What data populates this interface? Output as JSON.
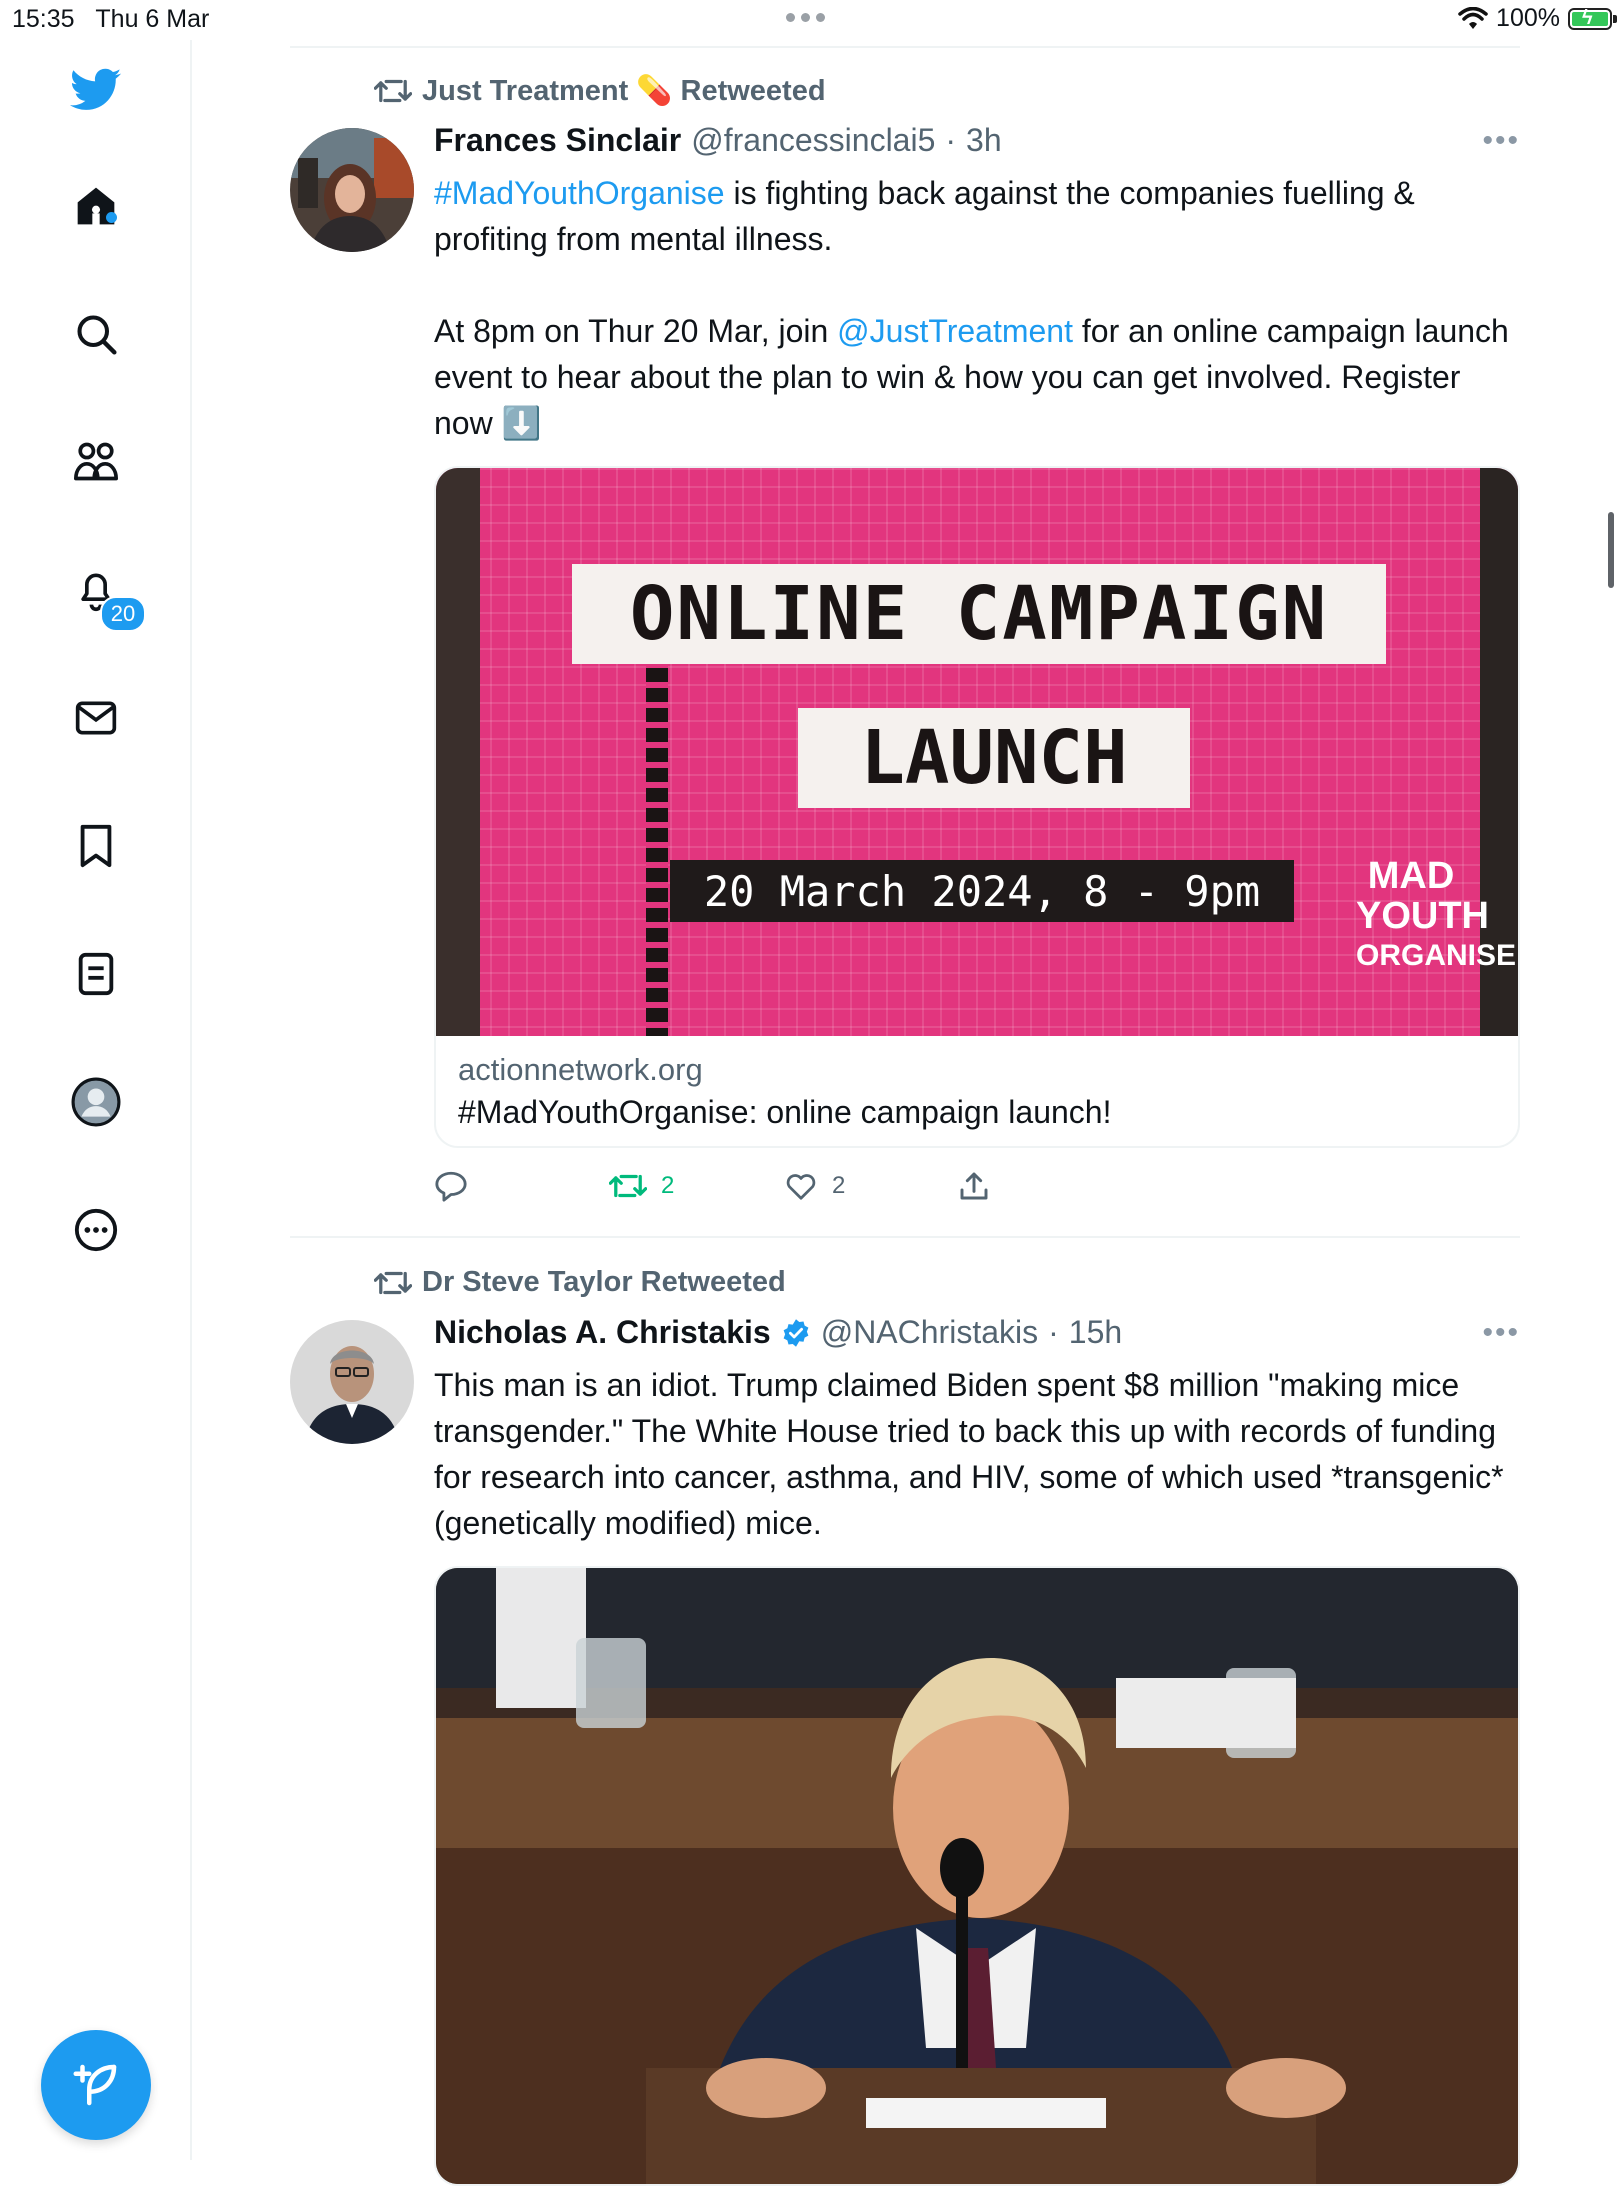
{
  "status_bar": {
    "time": "15:35",
    "date": "Thu 6 Mar",
    "battery": "100%"
  },
  "sidebar": {
    "notifications_badge": "20",
    "accent": "#1d9bf0"
  },
  "feed": {
    "tweets": [
      {
        "retweeted_by": "Just Treatment 💊 Retweeted",
        "name": "Frances Sinclair",
        "handle": "@francessinclai5",
        "time": "3h",
        "text_hashtag": "#MadYouthOrganise",
        "text_p1": " is fighting back against the companies fuelling & profiting from mental illness.",
        "text_p2_a": "At 8pm on Thur 20 Mar, join ",
        "text_mention": "@JustTreatment",
        "text_p2_b": " for an online campaign launch event to hear about the plan to win & how you can get involved. Register now ⬇️",
        "card": {
          "image_title_1": "ONLINE CAMPAIGN",
          "image_title_2": "LAUNCH",
          "image_date": "20 March 2024, 8 - 9pm",
          "image_logo_1": "MAD",
          "image_logo_2": "YOUTH",
          "image_logo_3": "ORGANISE",
          "domain": "actionnetwork.org",
          "title": "#MadYouthOrganise: online campaign launch!"
        },
        "actions": {
          "retweets": "2",
          "likes": "2"
        }
      },
      {
        "retweeted_by": "Dr Steve Taylor Retweeted",
        "name": "Nicholas A. Christakis",
        "handle": "@NAChristakis",
        "time": "15h",
        "verified": true,
        "text": "This man is an idiot. Trump claimed Biden spent $8 million \"making mice transgender.\" The White House tried to back this up with records of funding for research into cancer, asthma, and HIV, some of which used *transgenic* (genetically modified) mice."
      }
    ]
  }
}
